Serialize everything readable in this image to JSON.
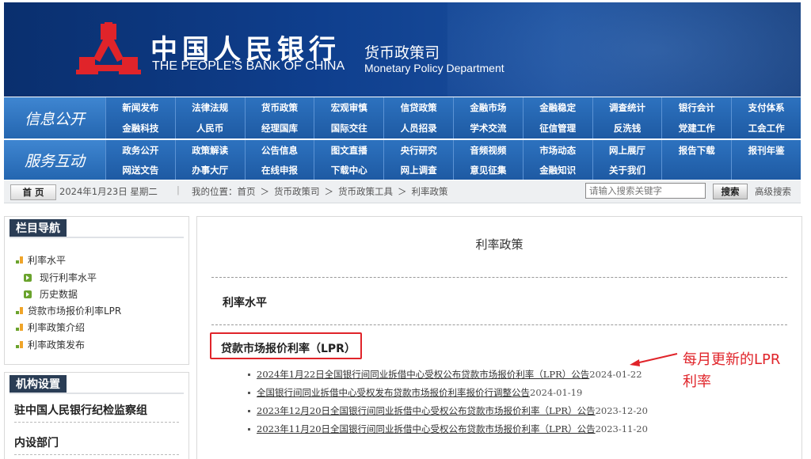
{
  "header": {
    "cn_title": "中国人民银行",
    "en_title": "THE PEOPLE'S BANK OF CHINA",
    "dept_cn": "货币政策司",
    "dept_en": "Monetary Policy Department",
    "logo_color": "#e0242a"
  },
  "nav": {
    "group1_label": "信息公开",
    "group1_items": [
      "新闻发布",
      "法律法规",
      "货币政策",
      "宏观审慎",
      "信贷政策",
      "金融市场",
      "金融稳定",
      "调查统计",
      "银行会计",
      "支付体系",
      "金融科技",
      "人民币",
      "经理国库",
      "国际交往",
      "人员招录",
      "学术交流",
      "征信管理",
      "反洗钱",
      "党建工作",
      "工会工作"
    ],
    "group2_label": "服务互动",
    "group2_items": [
      "政务公开",
      "政策解读",
      "公告信息",
      "图文直播",
      "央行研究",
      "音频视频",
      "市场动态",
      "网上展厅",
      "报告下载",
      "报刊年鉴",
      "网送文告",
      "办事大厅",
      "在线申报",
      "下载中心",
      "网上调查",
      "意见征集",
      "金融知识",
      "关于我们",
      "",
      ""
    ]
  },
  "crumbbar": {
    "home": "首 页",
    "date": "2024年1月23日  星期二",
    "separator": "|",
    "crumbs": [
      "我的位置：首页",
      "＞",
      "货币政策司",
      "＞",
      "货币政策工具",
      "＞",
      "利率政策"
    ],
    "search_placeholder": "请输入搜索关键字",
    "search_button": "搜索",
    "advanced": "高级搜索"
  },
  "sidebar": {
    "nav_title": "栏目导航",
    "items": [
      {
        "label": "利率水平",
        "level": 1
      },
      {
        "label": "现行利率水平",
        "level": 2
      },
      {
        "label": "历史数据",
        "level": 2
      },
      {
        "label": "贷款市场报价利率LPR",
        "level": 1
      },
      {
        "label": "利率政策介绍",
        "level": 1
      },
      {
        "label": "利率政策发布",
        "level": 1
      }
    ],
    "org_title": "机构设置",
    "org_items": [
      "驻中国人民银行纪检监察组",
      "内设部门"
    ]
  },
  "main": {
    "title": "利率政策",
    "section1": "利率水平",
    "section2": "贷款市场报价利率（LPR）",
    "links": [
      {
        "text": "2024年1月22日全国银行间同业拆借中心受权公布贷款市场报价利率（LPR）公告",
        "date": "2024-01-22"
      },
      {
        "text": "全国银行间同业拆借中心受权发布贷款市场报价利率报价行调整公告",
        "date": "2024-01-19"
      },
      {
        "text": "2023年12月20日全国银行间同业拆借中心受权公布贷款市场报价利率（LPR）公告",
        "date": "2023-12-20"
      },
      {
        "text": "2023年11月20日全国银行间同业拆借中心受权公布贷款市场报价利率（LPR）公告",
        "date": "2023-11-20"
      }
    ]
  },
  "annotation": {
    "line1": "每月更新的LPR",
    "line2": "利率",
    "color": "#e0242a"
  }
}
